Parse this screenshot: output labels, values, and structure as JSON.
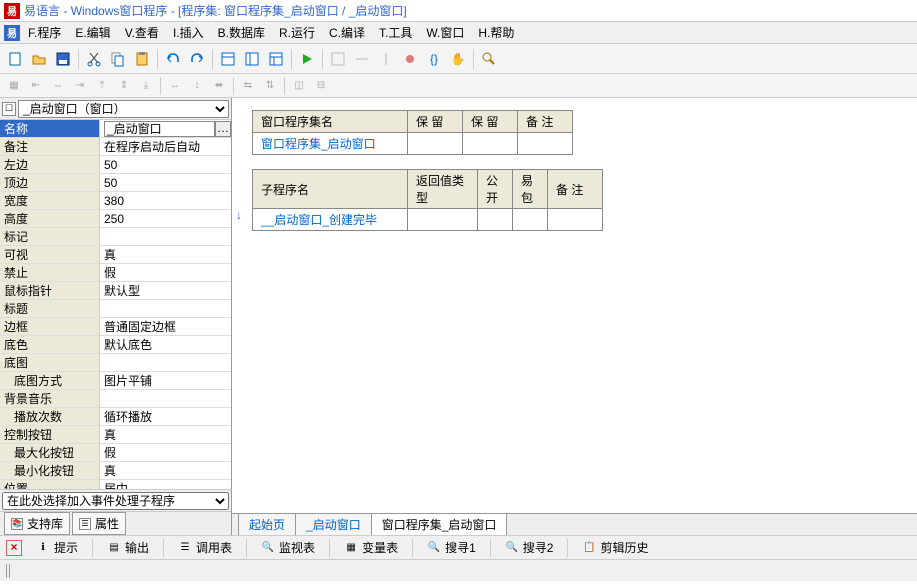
{
  "titlebar": {
    "app": "易语言",
    "sub": "Windows窗口程序",
    "doc": "[程序集: 窗口程序集_启动窗口 / _启动窗口]"
  },
  "menu": {
    "items": [
      "F.程序",
      "E.编辑",
      "V.查看",
      "I.插入",
      "B.数据库",
      "R.运行",
      "C.编译",
      "T.工具",
      "W.窗口",
      "H.帮助"
    ]
  },
  "combo": {
    "value": "_启动窗口（窗口）"
  },
  "props": [
    {
      "k": "名称",
      "v": "_启动窗口",
      "sel": true
    },
    {
      "k": "备注",
      "v": "在程序启动后自动"
    },
    {
      "k": "左边",
      "v": "50"
    },
    {
      "k": "顶边",
      "v": "50"
    },
    {
      "k": "宽度",
      "v": "380"
    },
    {
      "k": "高度",
      "v": "250"
    },
    {
      "k": "标记",
      "v": ""
    },
    {
      "k": "可视",
      "v": "真"
    },
    {
      "k": "禁止",
      "v": "假"
    },
    {
      "k": "鼠标指针",
      "v": "默认型"
    },
    {
      "k": "标题",
      "v": ""
    },
    {
      "k": "边框",
      "v": "普通固定边框"
    },
    {
      "k": "底色",
      "v": "默认底色"
    },
    {
      "k": "底图",
      "v": ""
    },
    {
      "k": "底图方式",
      "v": "图片平铺",
      "indent": true
    },
    {
      "k": "背景音乐",
      "v": ""
    },
    {
      "k": "播放次数",
      "v": "循环播放",
      "indent": true
    },
    {
      "k": "控制按钮",
      "v": "真"
    },
    {
      "k": "最大化按钮",
      "v": "假",
      "indent": true
    },
    {
      "k": "最小化按钮",
      "v": "真",
      "indent": true
    },
    {
      "k": "位置",
      "v": "居中"
    }
  ],
  "event_combo": "在此处选择加入事件处理子程序",
  "left_tabs": {
    "a": "支持库",
    "b": "属性"
  },
  "table1": {
    "headers": [
      "窗口程序集名",
      "保  留",
      "保  留",
      "备  注"
    ],
    "row": [
      "窗口程序集_启动窗口",
      "",
      "",
      ""
    ]
  },
  "table2": {
    "headers": [
      "子程序名",
      "返回值类型",
      "公开",
      "易包",
      "备  注"
    ],
    "row": [
      "__启动窗口_创建完毕",
      "",
      "",
      "",
      ""
    ]
  },
  "doc_tabs": {
    "a": "起始页",
    "b": "_启动窗口",
    "c": "窗口程序集_启动窗口"
  },
  "status_tabs": [
    "提示",
    "输出",
    "调用表",
    "监视表",
    "变量表",
    "搜寻1",
    "搜寻2",
    "剪辑历史"
  ]
}
